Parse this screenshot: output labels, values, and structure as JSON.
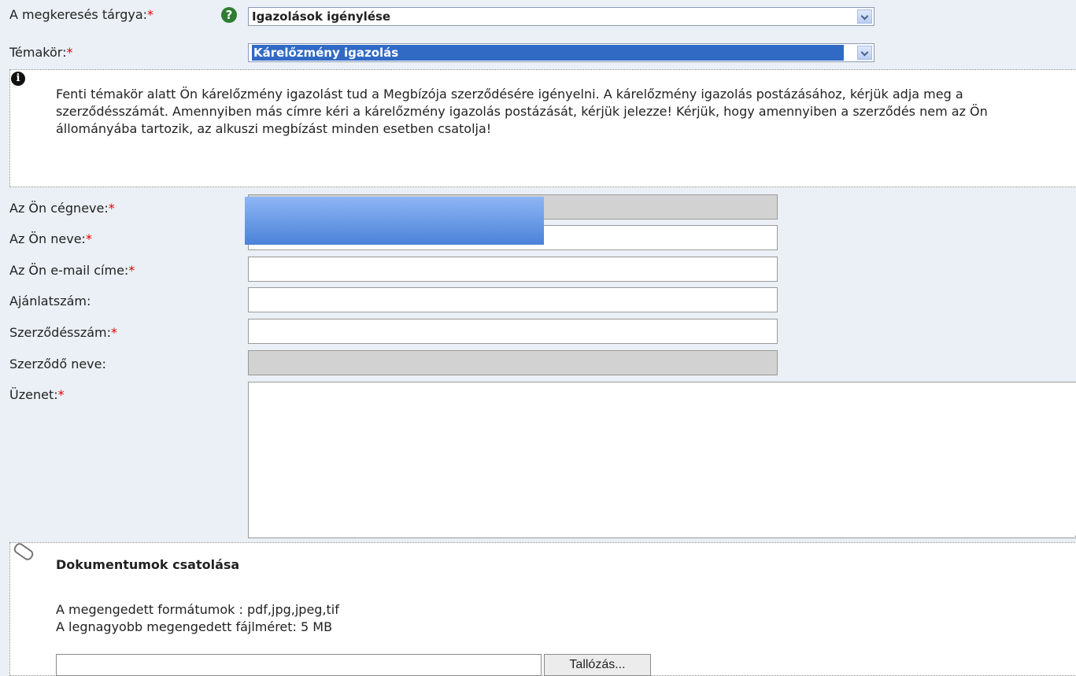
{
  "subject": {
    "label": "A megkeresés tárgya:",
    "required_mark": "*",
    "help_icon": "question-icon",
    "selected": "Igazolások igénylése"
  },
  "topic": {
    "label": "Témakör:",
    "required_mark": "*",
    "selected": "Kárelőzmény igazolás"
  },
  "info": {
    "icon": "info-icon",
    "text": "Fenti témakör alatt Ön kárelőzmény igazolást tud a Megbízója szerződésére igényelni. A kárelőzmény igazolás postázásához, kérjük adja meg a szerződésszámát. Amennyiben más címre kéri a kárelőzmény igazolás postázását, kérjük jelezze! Kérjük, hogy amennyiben a szerződés nem az Ön állományába tartozik, az alkuszi megbízást minden esetben csatolja!"
  },
  "fields": {
    "company": {
      "label": "Az Ön cégneve:",
      "required_mark": "*",
      "value": ""
    },
    "name": {
      "label": "Az Ön neve:",
      "required_mark": "*",
      "value": ""
    },
    "email": {
      "label": "Az Ön e-mail címe:",
      "required_mark": "*",
      "value": ""
    },
    "offer": {
      "label": "Ajánlatszám:",
      "value": ""
    },
    "contract": {
      "label": "Szerződésszám:",
      "required_mark": "*",
      "value": ""
    },
    "contractor": {
      "label": "Szerződő neve:",
      "value": ""
    },
    "message": {
      "label": "Üzenet:",
      "required_mark": "*",
      "value": ""
    }
  },
  "attachments": {
    "icon": "paperclip-icon",
    "title": "Dokumentumok csatolása",
    "formats": "A megengedett formátumok : pdf,jpg,jpeg,tif",
    "max_size": "A legnagyobb megengedett fájlméret: 5 MB",
    "browse_label": "Tallózás..."
  },
  "colors": {
    "required": "#e00000",
    "selection": "#316ac5",
    "background": "#eaf0f5"
  }
}
